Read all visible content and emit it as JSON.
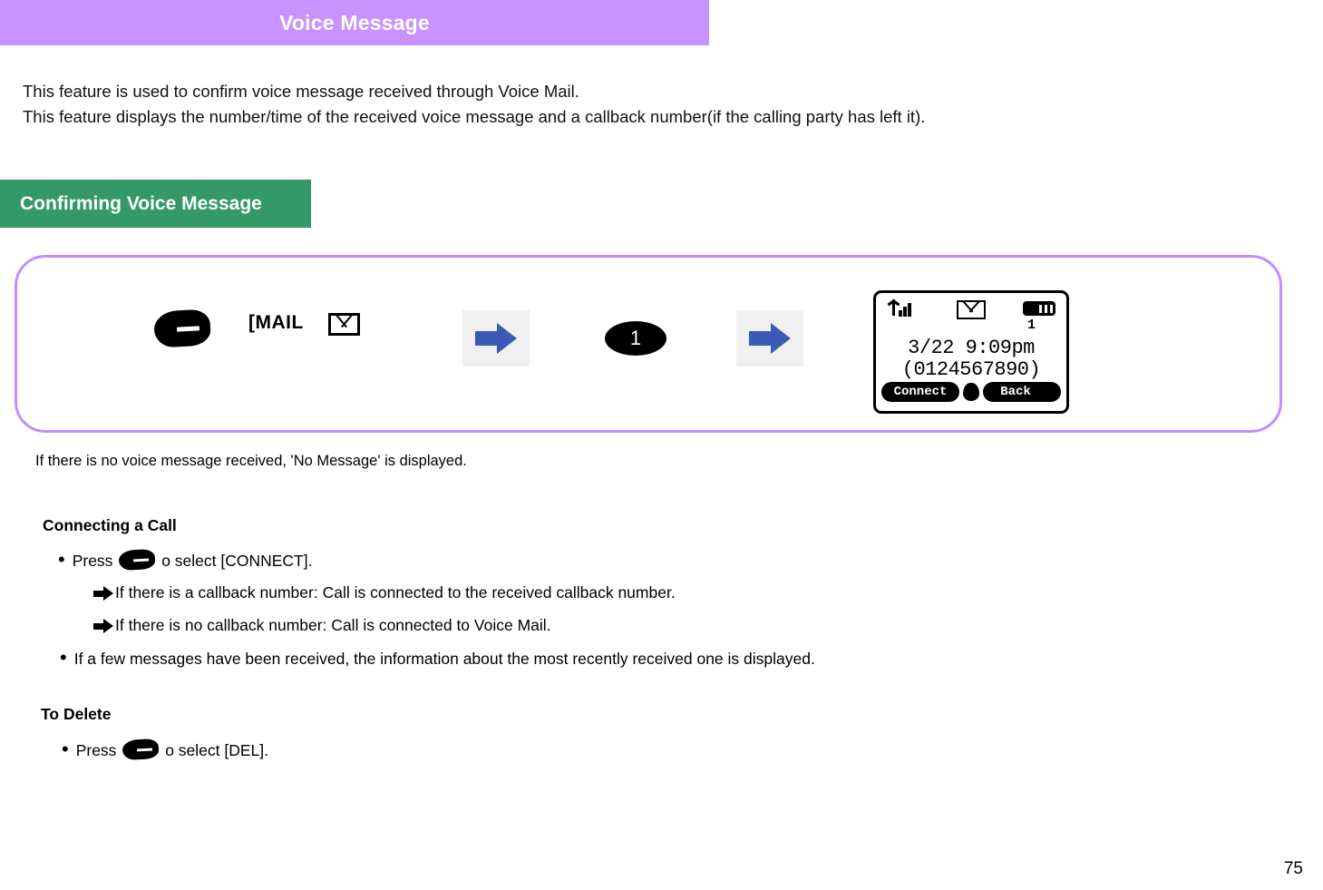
{
  "header": {
    "title": "Voice Message"
  },
  "intro": {
    "line1": "This feature is used to confirm voice message received through Voice Mail.",
    "line2": "This feature displays the number/time of the received voice message and a callback number(if the calling party has left it)."
  },
  "section": {
    "title": "Confirming Voice Message"
  },
  "flow": {
    "mail_label": "[MAIL",
    "mail_icon": "envelope-icon",
    "key_icon": "key-button-icon",
    "arrow_icon": "blue-right-arrow-icon",
    "digit_key": "1"
  },
  "phone_screen": {
    "signal_icon": "signal-bars-icon",
    "mail_icon": "envelope-icon",
    "battery_icon": "battery-icon",
    "message_count": "1",
    "date_time": "3/22  9:09pm",
    "callback_number": "(0124567890)",
    "softkey_left": "Connect",
    "softkey_right": "Back",
    "nav_icon": "nav-dot-icon"
  },
  "note": {
    "text": "If there is no voice message received, 'No Message' is displayed."
  },
  "connecting": {
    "heading": "Connecting a Call",
    "bullet_press_prefix": "Press",
    "bullet_press_suffix": "o select [CONNECT].",
    "sub_items": [
      "If there is a callback number: Call is connected to the received callback number.",
      "If there is no callback number: Call is connected to Voice Mail."
    ],
    "bullet_multi": "If a few messages have been received, the information about the most recently received one is displayed."
  },
  "delete": {
    "heading": "To Delete",
    "bullet_press_prefix": "Press",
    "bullet_press_suffix": "o select [DEL]."
  },
  "footer": {
    "page_number": "75"
  },
  "colors": {
    "title_bar": "#c993ff",
    "section_header": "#339966",
    "flow_box_border": "#c08fff",
    "arrow_blue": "#3b5ab5"
  }
}
